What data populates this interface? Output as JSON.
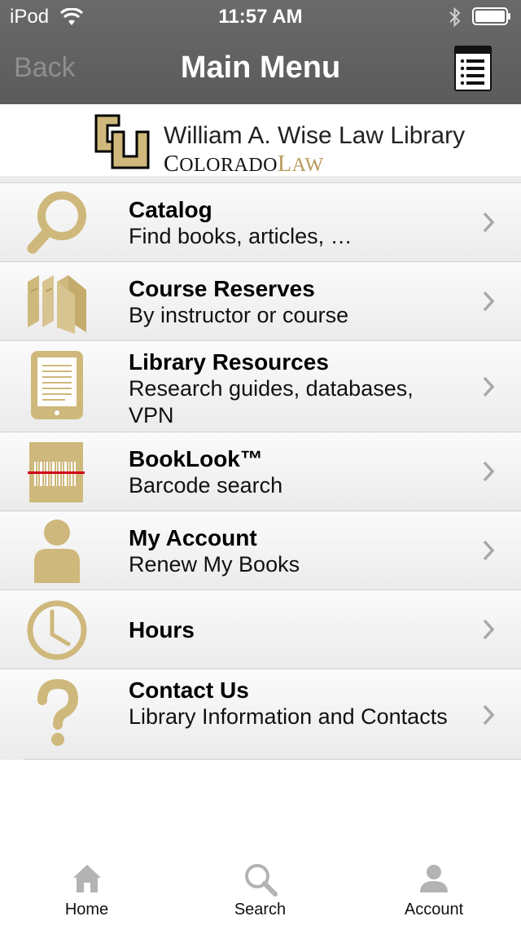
{
  "status_bar": {
    "carrier": "iPod",
    "time": "11:57 AM"
  },
  "nav": {
    "back_label": "Back",
    "title": "Main Menu",
    "right_icon": "list-icon"
  },
  "banner": {
    "library_name": "William A. Wise Law Library",
    "sub_part1_cap": "C",
    "sub_part1_rest": "OLORADO",
    "sub_part2_cap": "L",
    "sub_part2_rest": "AW",
    "logo_icon": "cu-logo-icon"
  },
  "colors": {
    "accent_gold": "#cfb87c",
    "nav_bg": "#5f5f5f",
    "chevron": "#a8a8a8"
  },
  "menu": [
    {
      "title": "Catalog",
      "subtitle": "Find books, articles, …",
      "icon": "magnifier-icon"
    },
    {
      "title": "Course Reserves",
      "subtitle": "By instructor or course",
      "icon": "books-icon"
    },
    {
      "title": "Library Resources",
      "subtitle": "Research guides, databases, VPN",
      "icon": "tablet-icon"
    },
    {
      "title": "BookLook™",
      "subtitle": "Barcode search",
      "icon": "barcode-icon"
    },
    {
      "title": "My Account",
      "subtitle": "Renew My Books",
      "icon": "person-icon"
    },
    {
      "title": "Hours",
      "subtitle": "",
      "icon": "clock-icon"
    },
    {
      "title": "Contact Us",
      "subtitle": "Library Information and Contacts",
      "icon": "question-icon"
    }
  ],
  "tabs": [
    {
      "label": "Home",
      "icon": "home-icon"
    },
    {
      "label": "Search",
      "icon": "search-icon"
    },
    {
      "label": "Account",
      "icon": "account-icon"
    }
  ]
}
